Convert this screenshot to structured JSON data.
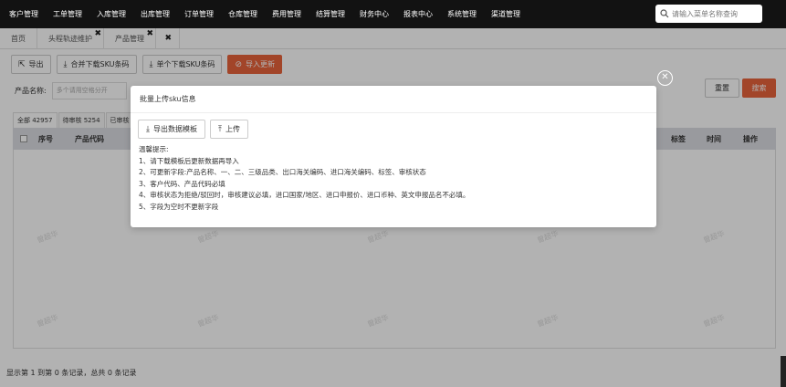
{
  "nav": {
    "items": [
      "客户管理",
      "工单管理",
      "入库管理",
      "出库管理",
      "订单管理",
      "仓库管理",
      "费用管理",
      "结算管理",
      "财务中心",
      "报表中心",
      "系统管理",
      "渠道管理"
    ],
    "search_placeholder": "请输入菜单名称查询"
  },
  "tabs": [
    {
      "label": "首页"
    },
    {
      "label": "头程轨迹维护"
    },
    {
      "label": "产品管理"
    }
  ],
  "toolbar": {
    "export": "导出",
    "merge_download": "合并下载SKU条码",
    "single_download": "单个下载SKU条码",
    "import_update": "导入更新"
  },
  "filter": {
    "product_name_label": "产品名称:",
    "product_name_placeholder": "多个请用空格分开",
    "reset": "重置",
    "search": "搜索"
  },
  "status_tabs": [
    "全部 42957",
    "待审核 5254",
    "已审核"
  ],
  "table": {
    "headers_left": [
      "序号",
      "产品代码"
    ],
    "headers_right": [
      "标签",
      "时间",
      "操作"
    ]
  },
  "footer": "显示第 1 到第 0 条记录，总共 0 条记录",
  "watermark": "曾超华",
  "modal": {
    "title": "批量上传sku信息",
    "export_template": "导出数据模板",
    "upload": "上传",
    "tips": [
      "温馨提示:",
      "1、请下载模板后更新数据再导入",
      "2、可更新字段:产品名称、一、二、三级品类、出口海关编码、进口海关编码、标签、审核状态",
      "3、客户代码、产品代码必填",
      "4、审核状态为拒绝/驳回时，审核建议必填，进口国家/地区、进口申报价、进口币种、英文申报品名不必填。",
      "5、字段为空时不更新字段"
    ]
  },
  "colors": {
    "accent": "#e8643c",
    "nav_bg": "#121212"
  }
}
